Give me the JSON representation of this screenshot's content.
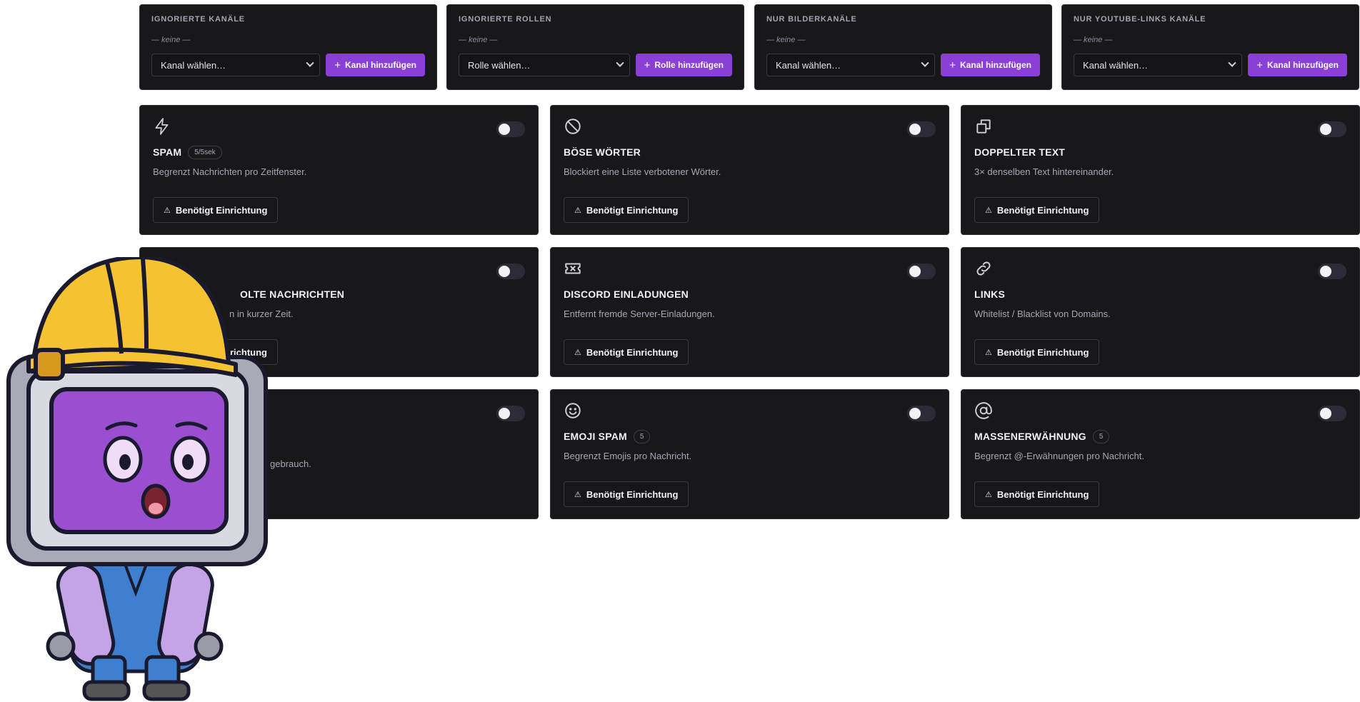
{
  "filters": [
    {
      "title": "IGNORIERTE KANÄLE",
      "empty": "— keine —",
      "select": "Kanal wählen…",
      "button": "Kanal hinzufügen"
    },
    {
      "title": "IGNORIERTE ROLLEN",
      "empty": "— keine —",
      "select": "Rolle wählen…",
      "button": "Rolle hinzufügen"
    },
    {
      "title": "NUR BILDERKANÄLE",
      "empty": "— keine —",
      "select": "Kanal wählen…",
      "button": "Kanal hinzufügen"
    },
    {
      "title": "NUR YOUTUBE-LINKS KANÄLE",
      "empty": "— keine —",
      "select": "Kanal wählen…",
      "button": "Kanal hinzufügen"
    }
  ],
  "rules": [
    {
      "icon": "lightning-icon",
      "title": "SPAM",
      "badge": "5/5sek",
      "desc": "Begrenzt Nachrichten pro Zeitfenster.",
      "button": "Benötigt Einrichtung",
      "enabled": false
    },
    {
      "icon": "ban-icon",
      "title": "BÖSE WÖRTER",
      "badge": "",
      "desc": "Blockiert eine Liste verbotener Wörter.",
      "button": "Benötigt Einrichtung",
      "enabled": false
    },
    {
      "icon": "copy-icon",
      "title": "DOPPELTER TEXT",
      "badge": "",
      "desc": "3× denselben Text hintereinander.",
      "button": "Benötigt Einrichtung",
      "enabled": false
    },
    {
      "icon": "repeat-icon",
      "title": "OLTE NACHRICHTEN",
      "badge": "",
      "desc": "n in kurzer Zeit.",
      "button": "richtung",
      "enabled": false
    },
    {
      "icon": "ticket-icon",
      "title": "DISCORD EINLADUNGEN",
      "badge": "",
      "desc": "Entfernt fremde Server-Einladungen.",
      "button": "Benötigt Einrichtung",
      "enabled": false
    },
    {
      "icon": "link-icon",
      "title": "LINKS",
      "badge": "",
      "desc": "Whitelist / Blacklist von Domains.",
      "button": "Benötigt Einrichtung",
      "enabled": false
    },
    {
      "icon": "unknown-icon",
      "title": "",
      "badge": "",
      "desc": "gebrauch.",
      "button": "",
      "enabled": false
    },
    {
      "icon": "smiley-icon",
      "title": "EMOJI SPAM",
      "badge": "5",
      "desc": "Begrenzt Emojis pro Nachricht.",
      "button": "Benötigt Einrichtung",
      "enabled": false
    },
    {
      "icon": "at-icon",
      "title": "MASSENERWÄHNUNG",
      "badge": "5",
      "desc": "Begrenzt @-Erwähnungen pro Nachricht.",
      "button": "Benötigt Einrichtung",
      "enabled": false
    }
  ],
  "mascot": {
    "name": "robot-mechanic-mascot"
  },
  "colors": {
    "accent": "#8a3fd6",
    "card_bg": "#18181b",
    "page_bg": "#ffffff"
  }
}
